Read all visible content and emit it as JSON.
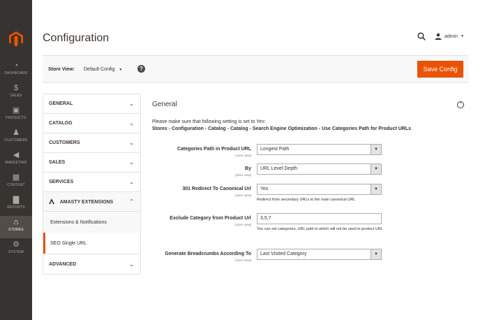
{
  "sidebar": {
    "items": [
      {
        "label": "DASHBOARD",
        "icon": "dashboard-icon",
        "glyph": "◔",
        "active": false
      },
      {
        "label": "SALES",
        "icon": "dollar-icon",
        "glyph": "$",
        "active": false
      },
      {
        "label": "PRODUCTS",
        "icon": "cube-icon",
        "glyph": "▣",
        "active": false
      },
      {
        "label": "CUSTOMERS",
        "icon": "person-icon",
        "glyph": "♟",
        "active": false
      },
      {
        "label": "MARKETING",
        "icon": "megaphone-icon",
        "glyph": "◀",
        "active": false
      },
      {
        "label": "CONTENT",
        "icon": "content-icon",
        "glyph": "▦",
        "active": false
      },
      {
        "label": "REPORTS",
        "icon": "bar-chart-icon",
        "glyph": "▇",
        "active": false
      },
      {
        "label": "STORES",
        "icon": "store-icon",
        "glyph": "⌂",
        "active": true
      },
      {
        "label": "SYSTEM",
        "icon": "gear-icon",
        "glyph": "⚙",
        "active": false
      }
    ]
  },
  "header": {
    "title": "Configuration",
    "user": "admin"
  },
  "storebar": {
    "label": "Store View:",
    "value": "Default Config",
    "save_label": "Save Config"
  },
  "tabs": {
    "general": "GENERAL",
    "catalog": "CATALOG",
    "customers": "CUSTOMERS",
    "sales": "SALES",
    "services": "SERVICES",
    "amasty": "AMASTY EXTENSIONS",
    "sub1": "Extensions & Notifications",
    "sub2": "SEO Single URL",
    "advanced": "ADVANCED"
  },
  "section": {
    "title": "General",
    "note_line1": "Please make sure that following setting is set to Yes:",
    "note_line2": "Stores - Configuration - Catalog - Catalog - Search Engine Optimization - Use Categories Path for Product URLs"
  },
  "fields": {
    "f1": {
      "label": "Categories Path in Product URL",
      "scope": "[store view]",
      "value": "Longest Path"
    },
    "f2": {
      "label": "By",
      "scope": "[store view]",
      "value": "URL Level Depth"
    },
    "f3": {
      "label": "301 Redirect To Canonical Url",
      "scope": "[store view]",
      "value": "Yes",
      "comment": "Redirect from secondary URLs to the main canonical URL"
    },
    "f4": {
      "label": "Exclude Category from Product Url",
      "scope": "[store view]",
      "value": "3,5,7",
      "comment": "You can set categories, URL path to which will not be used in product URL"
    },
    "f5": {
      "label": "Generate Breadcrumbs According To",
      "scope": "[store view]",
      "value": "Last Visited Category"
    }
  },
  "colors": {
    "accent": "#eb5202",
    "sidebar_bg": "#373330",
    "sidebar_active": "#524d49"
  }
}
